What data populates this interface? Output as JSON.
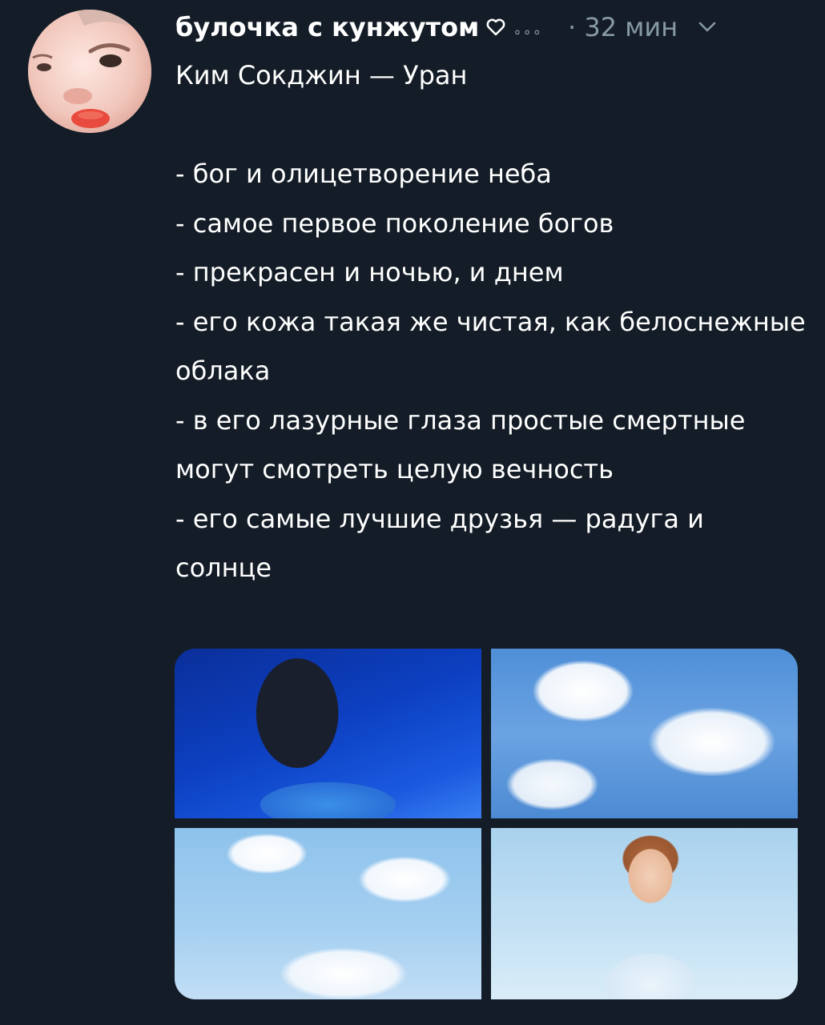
{
  "tweet": {
    "username": "булочка с кунжутом",
    "timestamp": "32 мин",
    "text": "Ким Сокджин — Уран\n\n- бог и олицетворение неба\n- самое первое поколение богов\n- прекрасен и ночью, и днем\n- его кожа такая же чистая, как белоснежные облака\n- в его лазурные глаза простые смертные могут смотреть целую вечность\n- его самые лучшие друзья — радуга и солнце"
  },
  "icons": {
    "heart": "heart-outline-icon",
    "more": "ellipsis-icon",
    "menu": "chevron-down-icon"
  },
  "colors": {
    "background": "#141d27",
    "secondary_text": "#8899a6"
  }
}
